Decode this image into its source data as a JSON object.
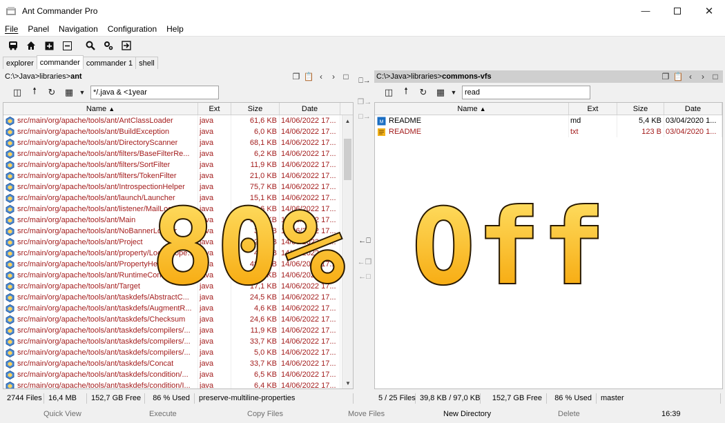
{
  "window": {
    "title": "Ant Commander Pro"
  },
  "menu": [
    "File",
    "Panel",
    "Navigation",
    "Configuration",
    "Help"
  ],
  "tabs": [
    {
      "label": "explorer",
      "active": false
    },
    {
      "label": "commander",
      "active": true
    },
    {
      "label": "commander 1",
      "active": false
    },
    {
      "label": "shell",
      "active": false
    }
  ],
  "left": {
    "path_prefix": "C:\\>Java>libraries>",
    "path_current": "ant",
    "filter": "*/.java & <1year",
    "columns": [
      "Name",
      "Ext",
      "Size",
      "Date"
    ],
    "rows": [
      {
        "name": "src/main/org/apache/tools/ant/AntClassLoader",
        "ext": "java",
        "size": "61,6 KB",
        "date": "14/06/2022 17..."
      },
      {
        "name": "src/main/org/apache/tools/ant/BuildException",
        "ext": "java",
        "size": "6,0 KB",
        "date": "14/06/2022 17..."
      },
      {
        "name": "src/main/org/apache/tools/ant/DirectoryScanner",
        "ext": "java",
        "size": "68,1 KB",
        "date": "14/06/2022 17..."
      },
      {
        "name": "src/main/org/apache/tools/ant/filters/BaseFilterRe...",
        "ext": "java",
        "size": "6,2 KB",
        "date": "14/06/2022 17..."
      },
      {
        "name": "src/main/org/apache/tools/ant/filters/SortFilter",
        "ext": "java",
        "size": "11,9 KB",
        "date": "14/06/2022 17..."
      },
      {
        "name": "src/main/org/apache/tools/ant/filters/TokenFilter",
        "ext": "java",
        "size": "21,0 KB",
        "date": "14/06/2022 17..."
      },
      {
        "name": "src/main/org/apache/tools/ant/IntrospectionHelper",
        "ext": "java",
        "size": "75,7 KB",
        "date": "14/06/2022 17..."
      },
      {
        "name": "src/main/org/apache/tools/ant/launch/Launcher",
        "ext": "java",
        "size": "15,1 KB",
        "date": "14/06/2022 17..."
      },
      {
        "name": "src/main/org/apache/tools/ant/listener/MailLogger",
        "ext": "java",
        "size": "17,6 KB",
        "date": "14/06/2022 17..."
      },
      {
        "name": "src/main/org/apache/tools/ant/Main",
        "ext": "java",
        "size": "50,1 KB",
        "date": "14/06/2022 17..."
      },
      {
        "name": "src/main/org/apache/tools/ant/NoBannerLogger",
        "ext": "java",
        "size": "3,1 KB",
        "date": "14/06/2022 17..."
      },
      {
        "name": "src/main/org/apache/tools/ant/Project",
        "ext": "java",
        "size": "92,1 KB",
        "date": "14/06/2022 17..."
      },
      {
        "name": "src/main/org/apache/tools/ant/property/LocalProperties",
        "ext": "java",
        "size": "4,6 KB",
        "date": "14/06/2022 17..."
      },
      {
        "name": "src/main/org/apache/tools/ant/PropertyHelper",
        "ext": "java",
        "size": "48,3 KB",
        "date": "14/06/2022 17..."
      },
      {
        "name": "src/main/org/apache/tools/ant/RuntimeConfigurable",
        "ext": "java",
        "size": "21,2 KB",
        "date": "14/06/2022 17..."
      },
      {
        "name": "src/main/org/apache/tools/ant/Target",
        "ext": "java",
        "size": "17,1 KB",
        "date": "14/06/2022 17..."
      },
      {
        "name": "src/main/org/apache/tools/ant/taskdefs/AbstractC...",
        "ext": "java",
        "size": "24,5 KB",
        "date": "14/06/2022 17..."
      },
      {
        "name": "src/main/org/apache/tools/ant/taskdefs/AugmentR...",
        "ext": "java",
        "size": "4,6 KB",
        "date": "14/06/2022 17..."
      },
      {
        "name": "src/main/org/apache/tools/ant/taskdefs/Checksum",
        "ext": "java",
        "size": "24,6 KB",
        "date": "14/06/2022 17..."
      },
      {
        "name": "src/main/org/apache/tools/ant/taskdefs/compilers/...",
        "ext": "java",
        "size": "11,9 KB",
        "date": "14/06/2022 17..."
      },
      {
        "name": "src/main/org/apache/tools/ant/taskdefs/compilers/...",
        "ext": "java",
        "size": "33,7 KB",
        "date": "14/06/2022 17..."
      },
      {
        "name": "src/main/org/apache/tools/ant/taskdefs/compilers/...",
        "ext": "java",
        "size": "5,0 KB",
        "date": "14/06/2022 17..."
      },
      {
        "name": "src/main/org/apache/tools/ant/taskdefs/Concat",
        "ext": "java",
        "size": "33,7 KB",
        "date": "14/06/2022 17..."
      },
      {
        "name": "src/main/org/apache/tools/ant/taskdefs/condition/...",
        "ext": "java",
        "size": "6,5 KB",
        "date": "14/06/2022 17..."
      },
      {
        "name": "src/main/org/apache/tools/ant/taskdefs/condition/I...",
        "ext": "java",
        "size": "6,4 KB",
        "date": "14/06/2022 17..."
      }
    ],
    "status": [
      "2744 Files",
      "16,4 MB",
      "152,7 GB Free",
      "86 % Used",
      "preserve-multiline-properties"
    ]
  },
  "right": {
    "path_prefix": "C:\\>Java>libraries>",
    "path_current": "commons-vfs",
    "filter": "read",
    "columns": [
      "Name",
      "Ext",
      "Size",
      "Date"
    ],
    "rows": [
      {
        "name": "README",
        "ext": "md",
        "size": "5,4 KB",
        "date": "03/04/2020 1...",
        "icon": "markdown-file-icon",
        "color": "#000000"
      },
      {
        "name": "README",
        "ext": "txt",
        "size": "123 B",
        "date": "03/04/2020 1...",
        "icon": "text-file-icon",
        "color": "#a31c1c"
      }
    ],
    "status": [
      "5 / 25 Files",
      "39,8 KB / 97,0 KB",
      "152,7 GB Free",
      "86 % Used",
      "master"
    ]
  },
  "fkeys": [
    {
      "label": "Quick View",
      "enabled": false
    },
    {
      "label": "Execute",
      "enabled": false
    },
    {
      "label": "Copy Files",
      "enabled": false
    },
    {
      "label": "Move Files",
      "enabled": false
    },
    {
      "label": "New Directory",
      "enabled": true
    },
    {
      "label": "Delete",
      "enabled": false
    }
  ],
  "clock": "16:39",
  "promo": {
    "text": "80% Off"
  },
  "colors": {
    "file_text": "#a31c1c",
    "promo_top": "#ffe36a",
    "promo_bottom": "#f5a000"
  }
}
